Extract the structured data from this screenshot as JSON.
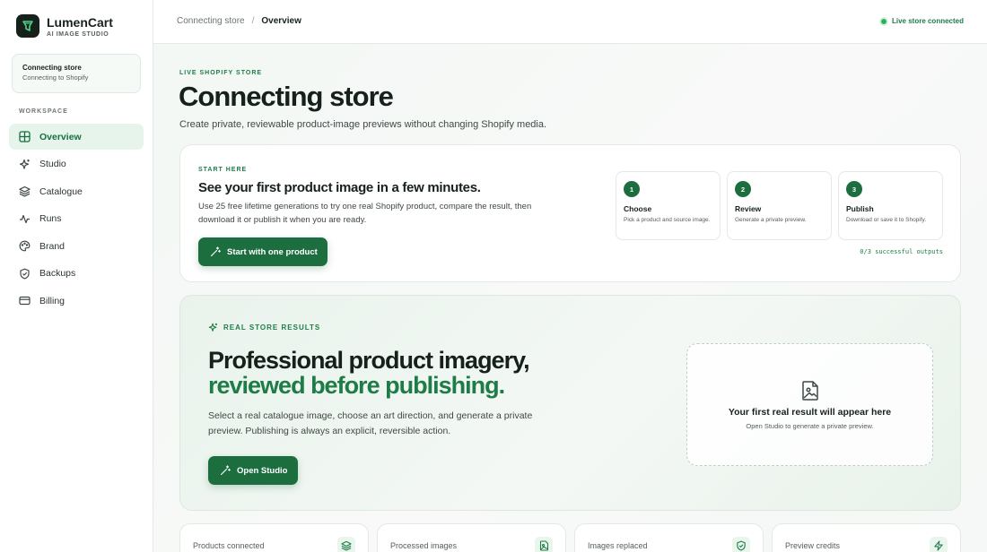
{
  "brand": {
    "name": "LumenCart",
    "subtitle": "AI IMAGE STUDIO"
  },
  "store_card": {
    "title": "Connecting store",
    "subtitle": "Connecting to Shopify"
  },
  "sidebar": {
    "section_label": "WORKSPACE",
    "items": [
      {
        "label": "Overview",
        "icon": "grid-icon",
        "active": true
      },
      {
        "label": "Studio",
        "icon": "sparkles-icon"
      },
      {
        "label": "Catalogue",
        "icon": "layers-icon"
      },
      {
        "label": "Runs",
        "icon": "activity-icon"
      },
      {
        "label": "Brand",
        "icon": "palette-icon"
      },
      {
        "label": "Backups",
        "icon": "shield-icon"
      },
      {
        "label": "Billing",
        "icon": "credit-card-icon"
      }
    ]
  },
  "topbar": {
    "breadcrumb": [
      "Connecting store",
      "Overview"
    ],
    "breadcrumb_separator": "/",
    "status": "Live store connected"
  },
  "header": {
    "eyebrow": "LIVE SHOPIFY STORE",
    "title": "Connecting store",
    "description": "Create private, reviewable product-image previews without changing Shopify media."
  },
  "start_card": {
    "eyebrow": "START HERE",
    "title": "See your first product image in a few minutes.",
    "description": "Use 25 free lifetime generations to try one real Shopify product, compare the result, then download it or publish it when you are ready.",
    "button_label": "Start with one product",
    "steps": [
      {
        "number": "1",
        "title": "Choose",
        "description": "Pick a product and source image."
      },
      {
        "number": "2",
        "title": "Review",
        "description": "Generate a private preview."
      },
      {
        "number": "3",
        "title": "Publish",
        "description": "Download or save it to Shopify."
      }
    ],
    "progress": "0/3 successful outputs"
  },
  "results_card": {
    "eyebrow": "REAL STORE RESULTS",
    "title_line1": "Professional product imagery,",
    "title_line2": "reviewed before publishing.",
    "description": "Select a real catalogue image, choose an art direction, and generate a private preview. Publishing is always an explicit, reversible action.",
    "button_label": "Open Studio",
    "placeholder": {
      "title": "Your first real result will appear here",
      "subtitle": "Open Studio to generate a private preview."
    }
  },
  "stats": [
    {
      "label": "Products connected",
      "icon": "layers-icon"
    },
    {
      "label": "Processed images",
      "icon": "image-file-icon"
    },
    {
      "label": "Images replaced",
      "icon": "shield-check-icon"
    },
    {
      "label": "Preview credits",
      "icon": "zap-icon"
    }
  ],
  "colors": {
    "accent": "#1c6e3f",
    "accent_text": "#1e7c47",
    "active_bg": "#e7f4ec",
    "live_dot": "#2bb062"
  }
}
